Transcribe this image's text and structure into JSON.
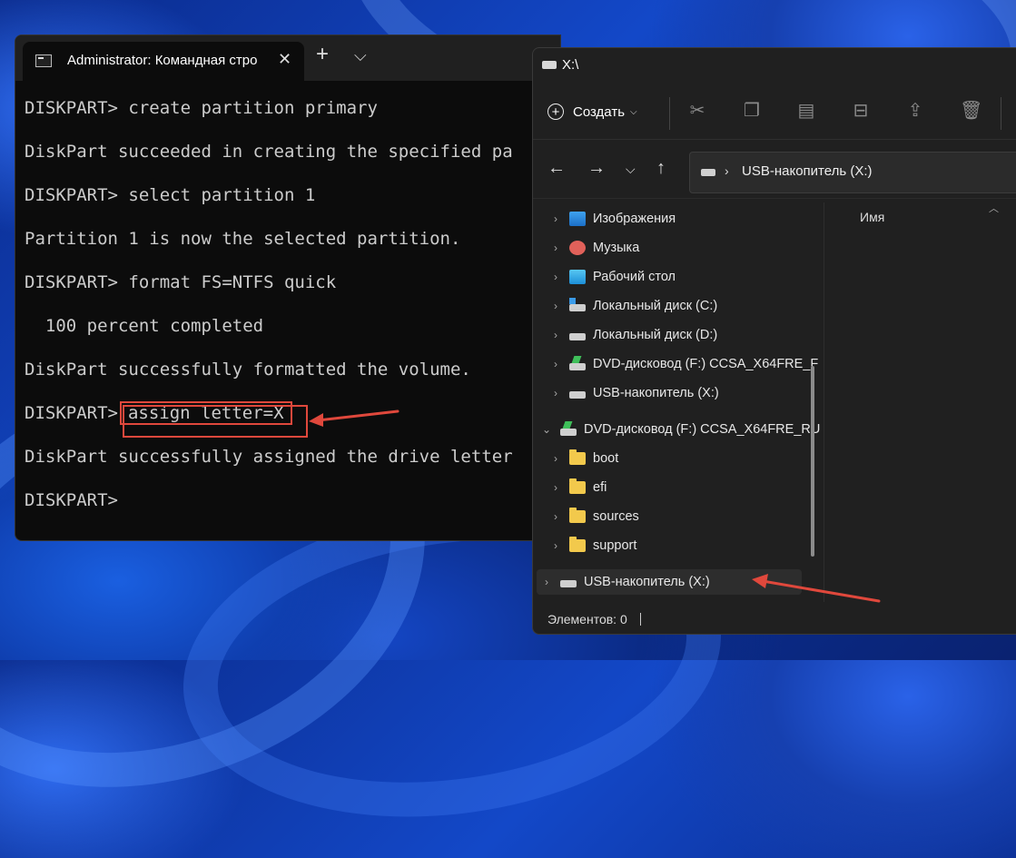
{
  "terminal": {
    "tab_title": "Administrator: Командная стро",
    "close_glyph": "✕",
    "new_tab_glyph": "+",
    "dropdown_glyph": "⌵",
    "lines": [
      "DISKPART> create partition primary",
      "DiskPart succeeded in creating the specified pa",
      "DISKPART> select partition 1",
      "Partition 1 is now the selected partition.",
      "DISKPART> format FS=NTFS quick",
      "  100 percent completed",
      "DiskPart successfully formatted the volume.",
      "",
      "DiskPart successfully assigned the drive letter",
      "DISKPART>"
    ],
    "prompt": "DISKPART>",
    "highlighted_command": "assign letter=X"
  },
  "explorer": {
    "window_title": "X:\\",
    "create_label": "Создать",
    "toolbar_icons": [
      "cut-icon",
      "copy-icon",
      "paste-icon",
      "rename-icon",
      "share-icon",
      "delete-icon"
    ],
    "address": "USB-накопитель (X:)",
    "tree": {
      "pictures": "Изображения",
      "music": "Музыка",
      "desktop": "Рабочий стол",
      "disk_c": "Локальный диск (C:)",
      "disk_d": "Локальный диск (D:)",
      "dvd_f": "DVD-дисковод (F:) CCSA_X64FRE_F",
      "usb_x": "USB-накопитель (X:)",
      "dvd_f_expanded": "DVD-дисковод (F:) CCSA_X64FRE_RU",
      "boot": "boot",
      "efi": "efi",
      "sources": "sources",
      "support": "support",
      "usb_x_selected": "USB-накопитель (X:)"
    },
    "column_name": "Имя",
    "status": "Элементов: 0"
  },
  "colors": {
    "highlight": "#e0483c",
    "terminal_bg": "#0c0c0c",
    "explorer_bg": "#202020"
  }
}
